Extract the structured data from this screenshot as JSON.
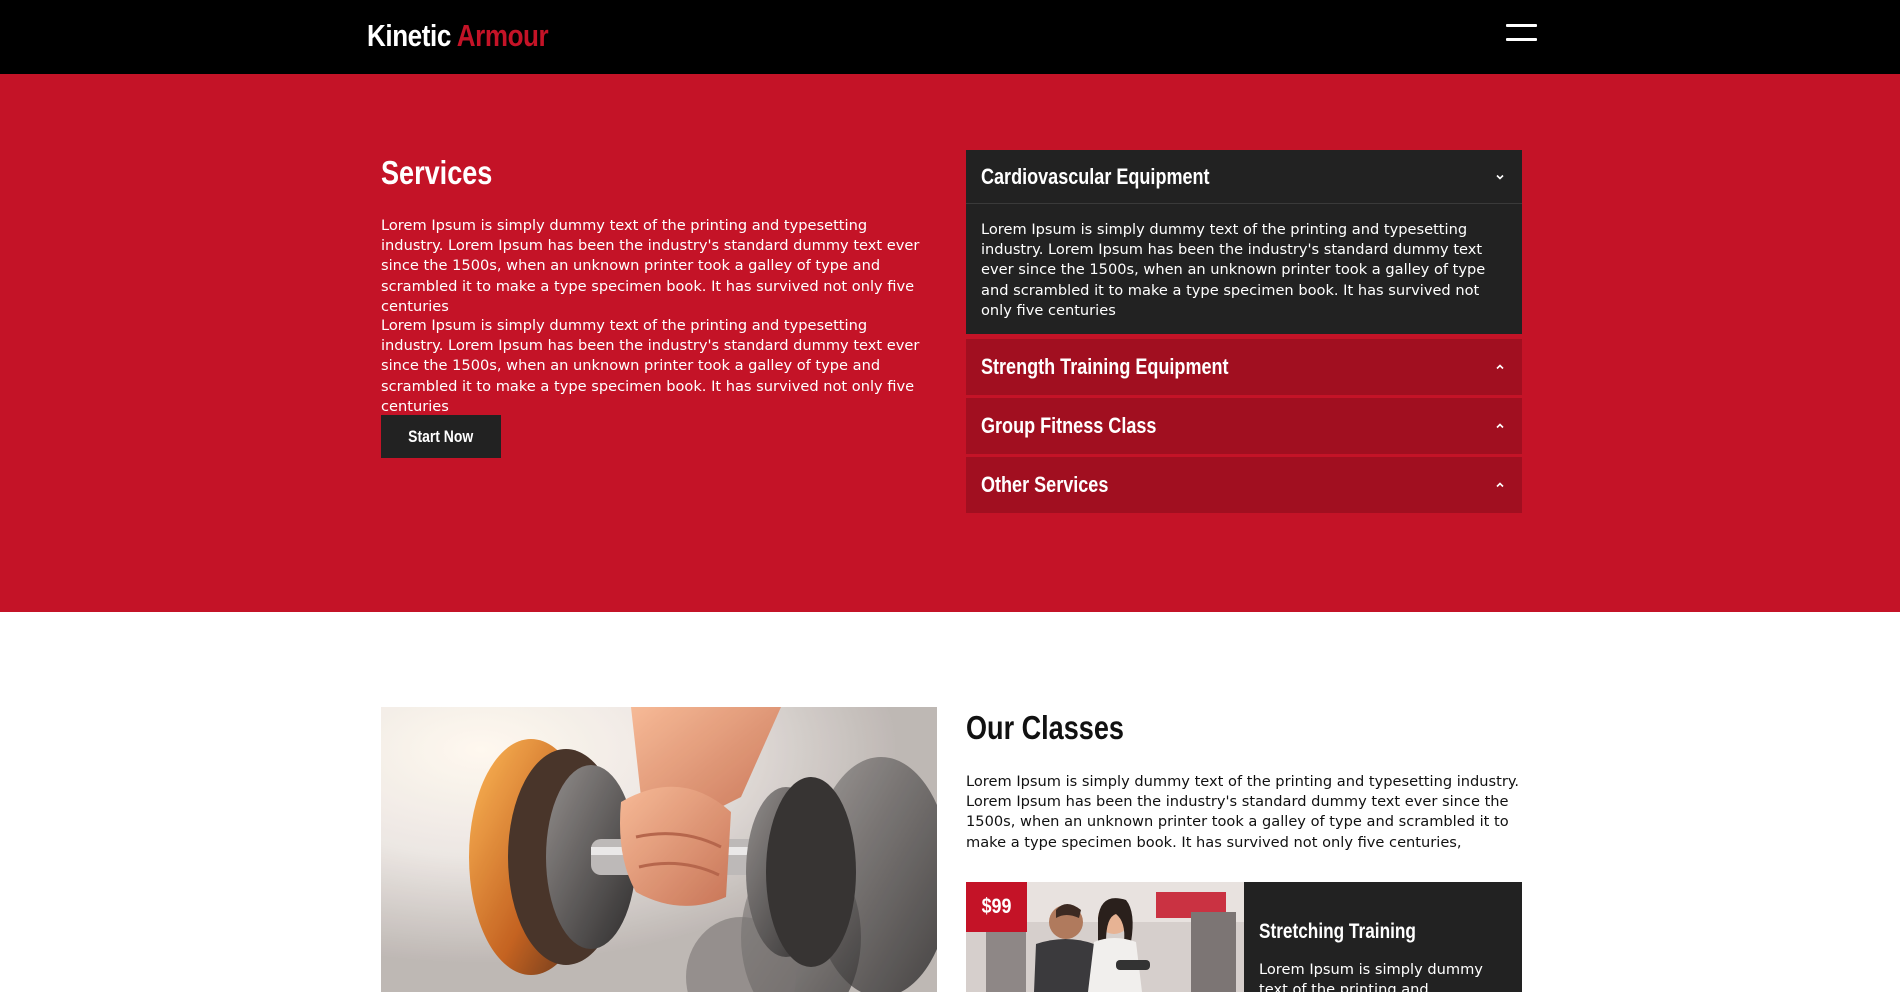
{
  "header": {
    "logo_part1": "Kinetic",
    "logo_part2": "Armour",
    "menu_icon": "hamburger-menu-icon"
  },
  "services": {
    "title": "Services",
    "paragraphs": [
      "Lorem Ipsum is simply dummy text of the printing and typesetting industry. Lorem Ipsum has been the industry's standard dummy text ever since the 1500s, when an unknown printer took a galley of type and scrambled it to make a type specimen book. It has survived not only five centuries",
      "Lorem Ipsum is simply dummy text of the printing and typesetting industry. Lorem Ipsum has been the industry's standard dummy text ever since the 1500s, when an unknown printer took a galley of type and scrambled it to make a type specimen book. It has survived not only five centuries"
    ],
    "button_label": "Start Now",
    "accordion": [
      {
        "title": "Cardiovascular Equipment",
        "expanded": true,
        "body": "Lorem Ipsum is simply dummy text of the printing and typesetting industry. Lorem Ipsum has been the industry's standard dummy text ever since the 1500s, when an unknown printer took a galley of type and scrambled it to make a type specimen book. It has survived not only five centuries"
      },
      {
        "title": "Strength Training Equipment",
        "expanded": false
      },
      {
        "title": "Group Fitness Class",
        "expanded": false
      },
      {
        "title": "Other Services",
        "expanded": false
      }
    ]
  },
  "classes": {
    "title": "Our Classes",
    "paragraph": "Lorem Ipsum is simply dummy text of the printing and typesetting industry. Lorem Ipsum has been the industry's standard dummy text ever since the 1500s, when an unknown printer took a galley of type and scrambled it to make a type specimen book. It has survived not only five centuries,",
    "card": {
      "price": "$99",
      "title": "Stretching Training",
      "text": "Lorem Ipsum is simply dummy text of the printing and typesetting"
    }
  },
  "colors": {
    "brand_red": "#c41327",
    "dark_red": "#a10f20",
    "dark_panel": "#222222",
    "header_bg": "#000000"
  }
}
